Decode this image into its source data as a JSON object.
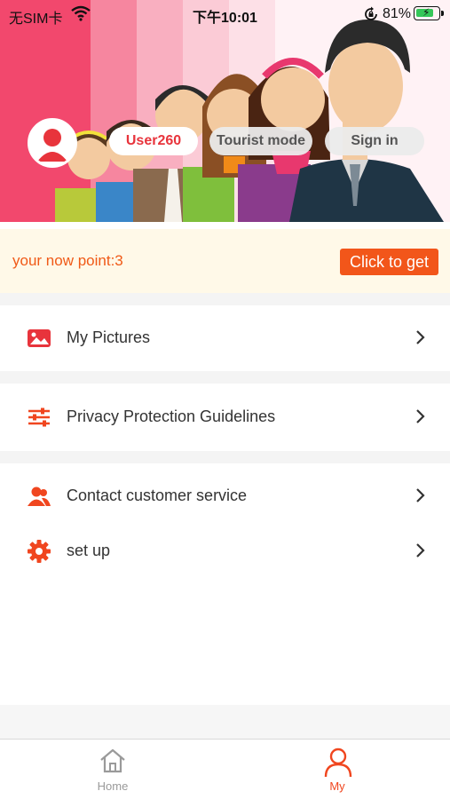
{
  "status_bar": {
    "carrier": "无SIM卡",
    "time": "下午10:01",
    "battery_percent": "81%",
    "battery_level": 0.81,
    "icons": [
      "wifi-icon",
      "rotation-lock-icon",
      "battery-charging-icon"
    ]
  },
  "profile": {
    "username": "User260",
    "tourist_label": "Tourist mode",
    "signin_label": "Sign in",
    "avatar_icon": "user-avatar-icon"
  },
  "points": {
    "text": "your now point:3",
    "button_label": "Click to get"
  },
  "menu": {
    "items": [
      {
        "label": "My Pictures",
        "icon": "picture-icon"
      },
      {
        "label": "Privacy Protection Guidelines",
        "icon": "sliders-icon"
      },
      {
        "label": "Contact customer service",
        "icon": "contact-users-icon"
      },
      {
        "label": "set up",
        "icon": "gear-icon"
      }
    ]
  },
  "tabbar": {
    "tabs": [
      {
        "label": "Home",
        "icon": "home-icon",
        "active": false
      },
      {
        "label": "My",
        "icon": "person-icon",
        "active": true
      }
    ]
  },
  "colors": {
    "accent": "#f2561a",
    "username_red": "#e8343c",
    "banner_pink": "#f2486d",
    "points_bg": "#fff9e8",
    "active_tab": "#f0461f"
  }
}
